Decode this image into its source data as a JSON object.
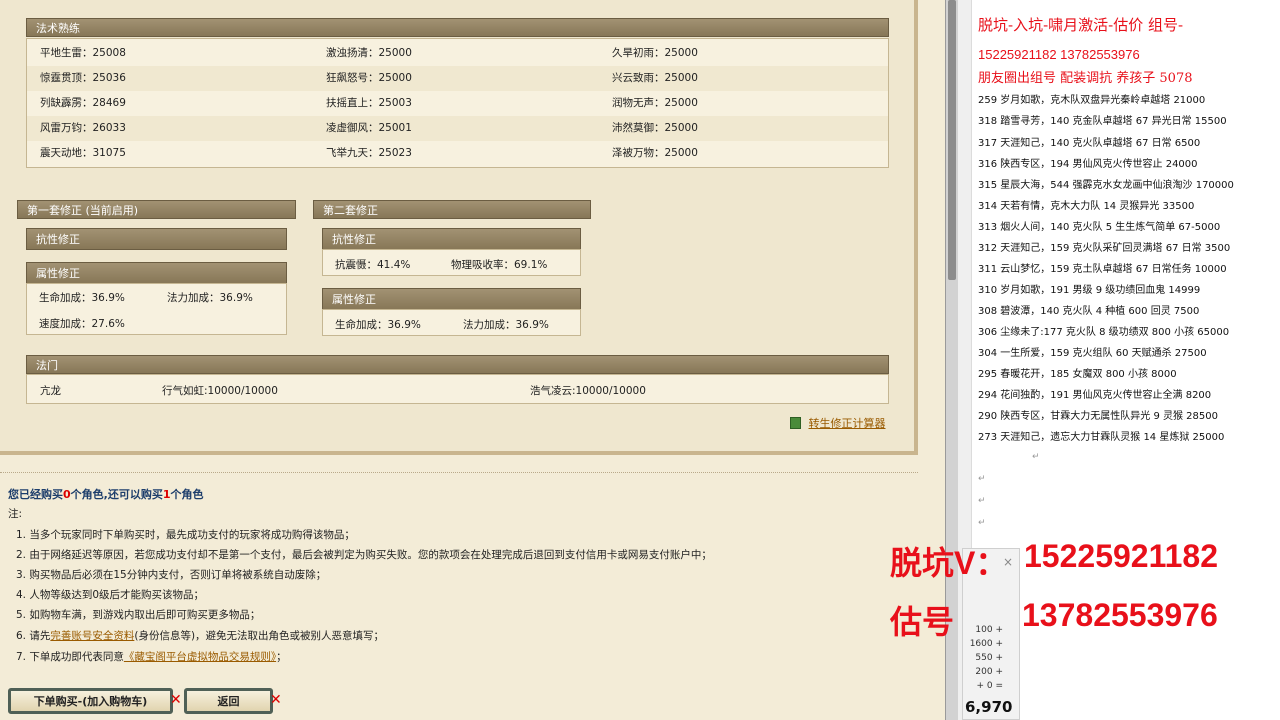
{
  "spells": {
    "title": "法术熟练",
    "rows": [
      [
        "平地生雷：25008",
        "激浊扬清：25000",
        "久旱初雨：25000"
      ],
      [
        "惊霆贯顶：25036",
        "狂飙怒号：25000",
        "兴云致雨：25000"
      ],
      [
        "列缺霹雳：28469",
        "扶摇直上：25003",
        "润物无声：25000"
      ],
      [
        "风雷万钧：26033",
        "凌虚御风：25001",
        "沛然莫御：25000"
      ],
      [
        "震天动地：31075",
        "飞举九天：25023",
        "泽被万物：25000"
      ]
    ]
  },
  "set1": {
    "title": "第一套修正 (当前启用)",
    "resist_title": "抗性修正",
    "attr_title": "属性修正",
    "attr": [
      "生命加成：36.9%",
      "法力加成：36.9%",
      "速度加成：27.6%"
    ]
  },
  "set2": {
    "title": "第二套修正",
    "resist_title": "抗性修正",
    "resist": [
      "抗震慑：41.4%",
      "物理吸收率：69.1%"
    ],
    "attr_title": "属性修正",
    "attr": [
      "生命加成：36.9%",
      "法力加成：36.9%"
    ]
  },
  "fame": {
    "title": "法门",
    "items": [
      "亢龙",
      "行气如虹:10000/10000",
      "浩气凌云:10000/10000"
    ]
  },
  "calc_link": "转生修正计算器",
  "purchase": {
    "status_pre": "您已经购买",
    "status_n1": "0",
    "status_mid": "个角色,还可以购买",
    "status_n2": "1",
    "status_post": "个角色",
    "note_label": "注:",
    "notes": [
      "1. 当多个玩家同时下单购买时，最先成功支付的玩家将成功购得该物品；",
      "2. 由于网络延迟等原因，若您成功支付却不是第一个支付，最后会被判定为购买失败。您的款项会在处理完成后退回到支付信用卡或网易支付账户中；",
      "3. 购买物品后必须在15分钟内支付，否则订单将被系统自动废除；",
      "4. 人物等级达到0级后才能购买该物品；",
      "5. 如购物车满，到游戏内取出后即可购买更多物品；"
    ],
    "note6_pre": "6. 请先",
    "note6_link": "完善账号安全资料",
    "note6_post": "(身份信息等)，避免无法取出角色或被别人恶意填写；",
    "note7_pre": "7. 下单成功即代表同意",
    "note7_link": "《藏宝阁平台虚拟物品交易规则》",
    "note7_post": "；",
    "buy_button": "下单购买-(加入购物车)",
    "back_button": "返回"
  },
  "doc": {
    "title1": "脱坑-入坑-啸月激活-估价 组号-",
    "title2": "15225921182   13782553976",
    "title3": "朋友圈出组号   配装调抗  养孩子 5078",
    "lines": [
      "259 岁月如歌，克木队双盘异光秦岭卓越塔 21000",
      "318 踏雪寻芳，140 克金队卓越塔 67 异光日常 15500",
      "317 天涯知己，140 克火队卓越塔 67 日常 6500",
      "316 陕西专区，194 男仙风克火传世容止 24000",
      "315 星辰大海，544 强霹克水女龙画中仙浪淘沙 170000",
      "314 天若有情，克木大力队 14 灵猴异光 33500",
      "313 烟火人间，140 克火队 5 生生炼气简单 67-5000",
      "312 天涯知己，159 克火队采矿回灵满塔 67 日常 3500",
      "311 云山梦忆，159 克土队卓越塔 67 日常任务 10000",
      "310 岁月如歌，191 男级 9 级功绩回血鬼 14999",
      "308 碧波潭，140 克火队 4 种植 600 回灵   7500",
      "306 尘缘未了:177 克火队 8 级功绩双 800 小孩 65000",
      "304 一生所爱，159 克火组队 60 天赋通杀 27500",
      "295 春暖花开，185 女魔双 800 小孩 8000",
      "294 花间独酌，191 男仙风克火传世容止全满 8200",
      "290 陕西专区，甘霖大力无属性队异光 9 灵猴 28500",
      "273 天涯知己，遗忘大力甘霖队灵猴 14 星炼狱 25000"
    ]
  },
  "overlay": {
    "line1_label": "脱坑V：",
    "line1_number": "15225921182",
    "line2_label": "估号",
    "line2_number": "13782553976"
  },
  "calc": {
    "close": "×",
    "lines": [
      "100  +",
      "1600  +",
      "550  +",
      "200  +",
      "+  0  ="
    ],
    "sum": "6,970"
  }
}
